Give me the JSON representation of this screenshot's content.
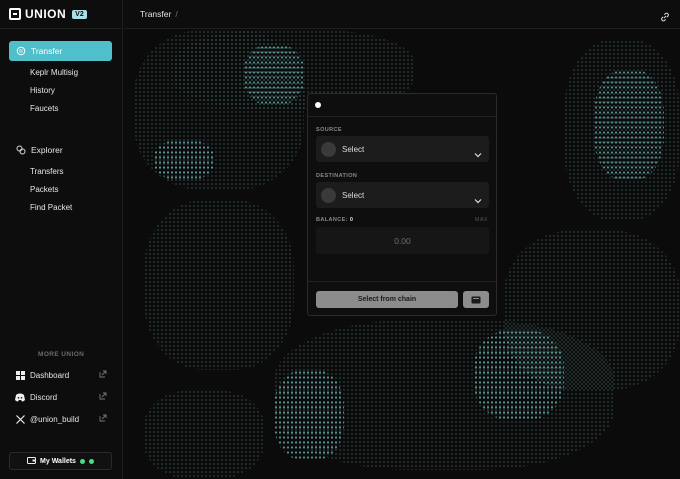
{
  "brand": {
    "name": "UNION",
    "badge": "V2"
  },
  "sidebar": {
    "primary": {
      "label": "Transfer",
      "icon": "transfer-icon"
    },
    "transfer_items": [
      {
        "label": "Keplr Multisig"
      },
      {
        "label": "History"
      },
      {
        "label": "Faucets"
      }
    ],
    "explorer": {
      "label": "Explorer",
      "icon": "explorer-icon"
    },
    "explorer_items": [
      {
        "label": "Transfers"
      },
      {
        "label": "Packets"
      },
      {
        "label": "Find Packet"
      }
    ],
    "more_title": "MORE UNION",
    "links": [
      {
        "label": "Dashboard",
        "icon": "dashboard-icon"
      },
      {
        "label": "Discord",
        "icon": "discord-icon"
      },
      {
        "label": "@union_build",
        "icon": "x-icon"
      }
    ],
    "wallets_label": "My Wallets"
  },
  "topbar": {
    "breadcrumb": "Transfer",
    "separator": "/"
  },
  "card": {
    "source_label": "SOURCE",
    "source_value": "Select",
    "destination_label": "DESTINATION",
    "destination_value": "Select",
    "balance_label": "BALANCE:",
    "balance_value": "0",
    "max_label": "MAX",
    "amount_placeholder": "0.00",
    "submit_label": "Select from chain"
  },
  "colors": {
    "accent": "#4fbfcc",
    "wallet_status": "#4ade80",
    "button": "#8c8c8c"
  }
}
